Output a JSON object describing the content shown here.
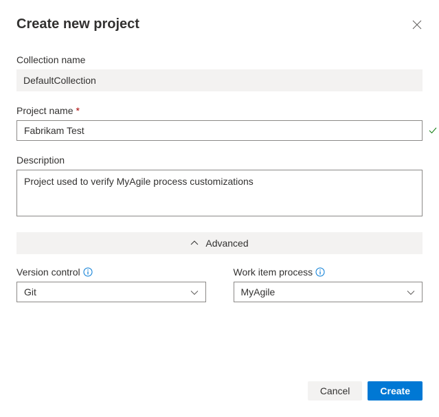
{
  "dialog": {
    "title": "Create new project"
  },
  "fields": {
    "collection": {
      "label": "Collection name",
      "value": "DefaultCollection"
    },
    "project": {
      "label": "Project name",
      "value": "Fabrikam Test"
    },
    "description": {
      "label": "Description",
      "value": "Project used to verify MyAgile process customizations"
    }
  },
  "advanced": {
    "toggle_label": "Advanced",
    "version_control": {
      "label": "Version control",
      "value": "Git"
    },
    "work_item_process": {
      "label": "Work item process",
      "value": "MyAgile"
    }
  },
  "buttons": {
    "cancel": "Cancel",
    "create": "Create"
  }
}
